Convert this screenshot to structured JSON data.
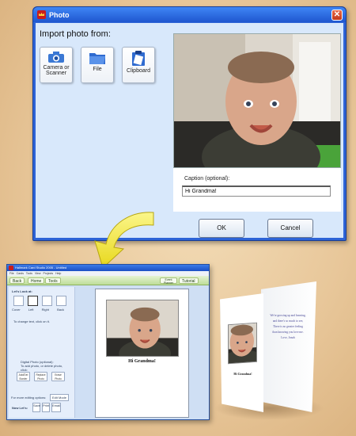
{
  "dialog": {
    "title": "Photo",
    "import_label": "Import photo from:",
    "sources": [
      {
        "label": "Camera or Scanner",
        "icon": "camera-icon"
      },
      {
        "label": "File",
        "icon": "folder-icon"
      },
      {
        "label": "Clipboard",
        "icon": "clipboard-icon"
      }
    ],
    "caption_label": "Caption (optional):",
    "caption_value": "Hi Grandma!",
    "ok_label": "OK",
    "cancel_label": "Cancel"
  },
  "app": {
    "title": "Hallmark Card Studio 2005 - Untitled",
    "menu": "File Cards Tools View Projects Help",
    "nav": {
      "back": "Back",
      "home": "Home",
      "tools": "Tools",
      "event_planner": "Event Planner",
      "tutorial": "Tutorial"
    },
    "left_panel": {
      "heading": "Let's Look at:",
      "thumbs": [
        "Cover",
        "Left",
        "Right",
        "Back"
      ],
      "change_hint": "To change text, click on it.",
      "digital_photo_label": "Digital Photo (optional):",
      "digital_photo_hint": "To add photo, or delete photo, click:",
      "buttons": [
        "Add/Del Border",
        "Replace Photo",
        "Erase Photo"
      ],
      "more_options": "For more editing options:",
      "edit_mode": "Edit Mode",
      "now_lets": "Now Let's:",
      "bottom_buttons": [
        "Save",
        "Print",
        "Email"
      ]
    },
    "card_caption": "Hi Grandma!"
  },
  "printed_card": {
    "caption": "Hi Grandma!",
    "verse": [
      "We're growing up and learning,",
      "and there's so much to see,",
      "There is no greater feeling",
      "than knowing you love me.",
      "Love, Jonah"
    ]
  },
  "colors": {
    "dialog_blue": "#2d63d6",
    "client_bg": "#d8e8fb",
    "arrow_yellow": "#f2ea4a",
    "background_tan": "#e8c79a"
  }
}
